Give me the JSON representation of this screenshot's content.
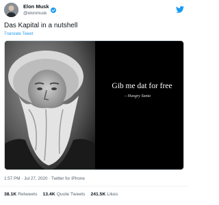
{
  "tweet": {
    "display_name": "Elon Musk",
    "handle": "@elonmusk",
    "text": "Das Kapital in a nutshell",
    "translate_label": "Translate Tweet",
    "media": {
      "quote": "Gib me dat for free",
      "attribution": "– Hungry Santa"
    },
    "time": "1:57 PM",
    "date": "Jul 27, 2020",
    "source": "Twitter for iPhone",
    "separator": "·",
    "stats": {
      "retweets_count": "38.1K",
      "retweets_label": "Retweets",
      "quote_tweets_count": "13.4K",
      "quote_tweets_label": "Quote Tweets",
      "likes_count": "241.5K",
      "likes_label": "Likes"
    }
  },
  "colors": {
    "brand_blue": "#1d9bf0",
    "text_primary": "#0f1419",
    "text_secondary": "#536471"
  },
  "icons": {
    "verified": "verified-badge-icon",
    "twitter_logo": "twitter-bird-icon"
  }
}
